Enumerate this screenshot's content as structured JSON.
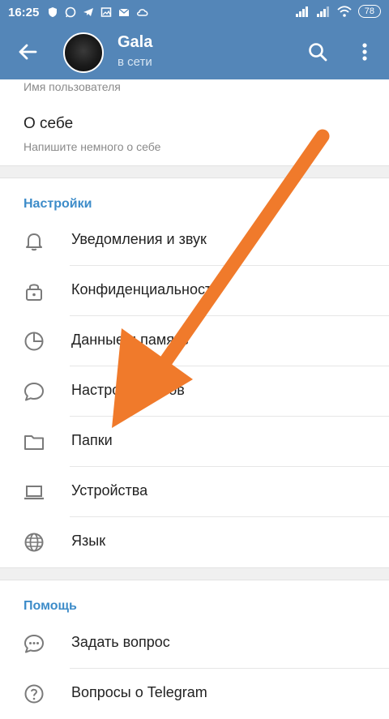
{
  "status_bar": {
    "time": "16:25",
    "battery": "78"
  },
  "header": {
    "name": "Gala",
    "status": "в сети"
  },
  "account": {
    "username_hint": "Имя пользователя",
    "about_title": "О себе",
    "about_hint": "Напишите немного о себе"
  },
  "settings": {
    "title": "Настройки",
    "items": [
      {
        "label": "Уведомления и звук",
        "icon": "bell-icon"
      },
      {
        "label": "Конфиденциальность",
        "icon": "lock-icon"
      },
      {
        "label": "Данные и память",
        "icon": "pie-chart-icon"
      },
      {
        "label": "Настройки чатов",
        "icon": "chat-bubble-icon"
      },
      {
        "label": "Папки",
        "icon": "folder-icon"
      },
      {
        "label": "Устройства",
        "icon": "laptop-icon"
      },
      {
        "label": "Язык",
        "icon": "globe-icon"
      }
    ]
  },
  "help": {
    "title": "Помощь",
    "items": [
      {
        "label": "Задать вопрос",
        "icon": "question-bubble-icon"
      },
      {
        "label": "Вопросы о Telegram",
        "icon": "help-circle-icon"
      }
    ]
  },
  "colors": {
    "header": "#5486b8",
    "accent": "#3d8cc9",
    "arrow": "#f07a2b"
  }
}
